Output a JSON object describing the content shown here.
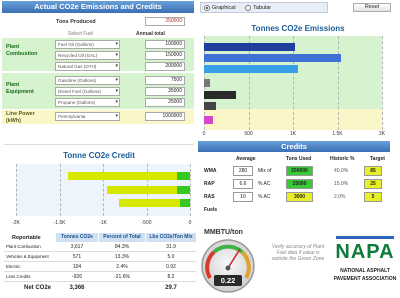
{
  "header": {
    "title": "Actual CO2e Emissions and Credits"
  },
  "view": {
    "option1": "Graphical",
    "option2": "Tabular",
    "reset": "Reset"
  },
  "inputs": {
    "tons_produced_label": "Tons Produced",
    "tons_produced": "250000",
    "select_fuel_label": "Select Fuel",
    "annual_total_label": "Annual total",
    "plant_combustion_label": "Plant Combustion",
    "plant_equipment_label": "Plant Equipment",
    "line_power_label": "Line Power (kWh)",
    "fuels": [
      {
        "name": "Fuel Oil (Gallons)",
        "value": "100000"
      },
      {
        "name": "Recycled Oil (GAL)",
        "value": "150000"
      },
      {
        "name": "Natural Gas (DTH)",
        "value": "200000"
      },
      {
        "name": "Gasoline (Gallons)",
        "value": "7500"
      },
      {
        "name": "Diesel Fuel (Gallons)",
        "value": "35000"
      },
      {
        "name": "Propane (Gallons)",
        "value": "25000"
      },
      {
        "name": "Pennsylvania",
        "value": "1000000"
      }
    ]
  },
  "emissions_chart": {
    "title": "Tonnes CO2e Emissions",
    "chart_data": {
      "type": "bar",
      "orientation": "horizontal",
      "title": "Tonnes CO2e Emissions",
      "categories": [
        "Fuel Oil",
        "Recycled Oil",
        "Natural Gas",
        "Gasoline",
        "Diesel Fuel",
        "Propane",
        "Line Power"
      ],
      "values": [
        1020,
        1540,
        1060,
        66,
        360,
        140,
        100
      ],
      "colors": [
        "#1f3f9e",
        "#3f72d6",
        "#3aa0e6",
        "#777777",
        "#2a2a2a",
        "#444444",
        "#d646c8"
      ],
      "xlim": [
        0,
        2000
      ],
      "xticks": [
        "0",
        "500",
        "1K",
        "1.5K",
        "2K"
      ]
    }
  },
  "credit_chart": {
    "title": "Tonne CO2e Credit",
    "chart_data": {
      "type": "bar",
      "orientation": "horizontal",
      "title": "Tonne CO2e Credit",
      "series": [
        {
          "values": [
            -1250,
            -800,
            -700
          ],
          "color": "#d6e800"
        },
        {
          "values": [
            -150,
            -150,
            -120
          ],
          "color": "#37c81f"
        }
      ],
      "xlim": [
        -2000,
        0
      ],
      "xticks": [
        "-2K",
        "-1.5K",
        "-1K",
        "-500",
        "0"
      ]
    }
  },
  "credits": {
    "title": "Credits",
    "headers": {
      "average": "Average",
      "tons_used": "Tons Used",
      "historic": "Historic %",
      "target": "Target"
    },
    "rows": [
      {
        "label": "WMA",
        "average": "280",
        "tons": "200000",
        "unit": "Mix of",
        "historic": "40.0%",
        "target": "85"
      },
      {
        "label": "RAP",
        "average": "6.6",
        "tons": "25000",
        "unit": "% AC",
        "historic": "15.0%",
        "target": "25"
      },
      {
        "label": "RAS",
        "average": "10",
        "tons": "3000",
        "unit": "% AC",
        "historic": "2.0%",
        "target": "5"
      }
    ],
    "fuels_label": "Fuels"
  },
  "report": {
    "title": "Reportable",
    "headers": [
      "Tonnes CO2e",
      "Percent of Total",
      "Lbs CO2e/Ton Mix"
    ],
    "rows": [
      {
        "name": "Plant Combustion",
        "t": "3,617",
        "p": "84.3%",
        "l": "31.9"
      },
      {
        "name": "Vehicles & Equipment",
        "t": "571",
        "p": "13.3%",
        "l": "5.0"
      },
      {
        "name": "Electric",
        "t": "104",
        "p": "2.4%",
        "l": "0.92"
      },
      {
        "name": "Less Credits",
        "t": "-926",
        "p": "-21.6%",
        "l": "8.2"
      }
    ],
    "net_label": "Net CO2e",
    "net_t": "3,366",
    "net_l": "29.7"
  },
  "gauge": {
    "title": "MMBTU/ton",
    "value": "0.22",
    "level": 0.12
  },
  "note": "Verify accuracy of Plant Fuel data if value is outside the Green Zone",
  "logo": {
    "name": "NAPA",
    "sub1": "NATIONAL ASPHALT",
    "sub2": "PAVEMENT ASSOCIATION"
  }
}
